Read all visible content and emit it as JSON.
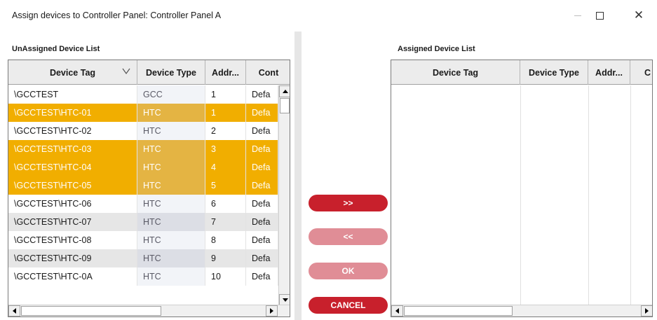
{
  "window": {
    "title": "Assign devices to Controller Panel: Controller Panel A",
    "controls": {
      "minimize": "minimize-icon",
      "maximize": "maximize-icon",
      "close": "close-icon"
    }
  },
  "left_pane": {
    "label": "UnAssigned Device List",
    "columns": [
      "Device Tag",
      "Device Type",
      "Addr...",
      "Cont"
    ],
    "rows": [
      {
        "tag": "\\GCCTEST",
        "type": "GCC",
        "addr": "1",
        "cont": "Defa",
        "selected": false
      },
      {
        "tag": "\\GCCTEST\\HTC-01",
        "type": "HTC",
        "addr": "1",
        "cont": "Defa",
        "selected": true
      },
      {
        "tag": "\\GCCTEST\\HTC-02",
        "type": "HTC",
        "addr": "2",
        "cont": "Defa",
        "selected": false
      },
      {
        "tag": "\\GCCTEST\\HTC-03",
        "type": "HTC",
        "addr": "3",
        "cont": "Defa",
        "selected": true
      },
      {
        "tag": "\\GCCTEST\\HTC-04",
        "type": "HTC",
        "addr": "4",
        "cont": "Defa",
        "selected": true
      },
      {
        "tag": "\\GCCTEST\\HTC-05",
        "type": "HTC",
        "addr": "5",
        "cont": "Defa",
        "selected": true
      },
      {
        "tag": "\\GCCTEST\\HTC-06",
        "type": "HTC",
        "addr": "6",
        "cont": "Defa",
        "selected": false
      },
      {
        "tag": "\\GCCTEST\\HTC-07",
        "type": "HTC",
        "addr": "7",
        "cont": "Defa",
        "selected": false
      },
      {
        "tag": "\\GCCTEST\\HTC-08",
        "type": "HTC",
        "addr": "8",
        "cont": "Defa",
        "selected": false
      },
      {
        "tag": "\\GCCTEST\\HTC-09",
        "type": "HTC",
        "addr": "9",
        "cont": "Defa",
        "selected": false
      },
      {
        "tag": "\\GCCTEST\\HTC-0A",
        "type": "HTC",
        "addr": "10",
        "cont": "Defa",
        "selected": false
      }
    ]
  },
  "right_pane": {
    "label": "Assigned Device List",
    "columns": [
      "Device Tag",
      "Device Type",
      "Addr...",
      "C"
    ],
    "rows": []
  },
  "actions": {
    "move_right": {
      "label": ">>",
      "enabled": true
    },
    "move_left": {
      "label": "<<",
      "enabled": false
    },
    "ok": {
      "label": "OK",
      "enabled": false
    },
    "cancel": {
      "label": "CANCEL",
      "enabled": true
    }
  },
  "colors": {
    "selected_row": "#f1ae00",
    "button_active": "#c8202c",
    "button_disabled": "#e08d96",
    "alt_row": "#e6e6e6"
  }
}
